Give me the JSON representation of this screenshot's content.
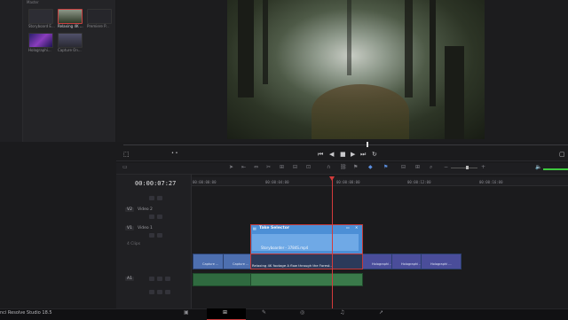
{
  "media_pool": {
    "header": "Master",
    "clips": [
      {
        "name": "Storyboard E...",
        "color": "#2d2d34"
      },
      {
        "name": "Relaxing 4K ...",
        "color": "#3b4233"
      },
      {
        "name": "Premiere P...",
        "color": "#26262b"
      },
      {
        "name": "Holographi...",
        "color": "#4a2f6e"
      },
      {
        "name": "Capture On...",
        "color": "#333338"
      }
    ]
  },
  "viewer": {
    "timecode": "00:00:07:27"
  },
  "timeline": {
    "ruler_labels": [
      "00:00:00:00",
      "00:00:04:00",
      "00:00:08:00",
      "00:00:12:00",
      "00:00:16:00"
    ],
    "tracks": [
      {
        "id": "V2",
        "name": "Video 2"
      },
      {
        "id": "V1",
        "name": "Video 1",
        "sub": "4 Clips"
      },
      {
        "id": "A1",
        "name": ""
      }
    ],
    "take_selector": {
      "title": "Take Selector",
      "clip_name": "Storyboarder - 3784S.mp4"
    },
    "selected_clip_label": "Relaxing 4K footage   A flow through the Forest...",
    "video_clips": [
      "Capture ...",
      "Capture ...",
      "Holographi ...",
      "Holographi ...",
      "Holographi ..."
    ]
  },
  "footer": {
    "app_name": "nci Resolve Studio 18.5"
  }
}
